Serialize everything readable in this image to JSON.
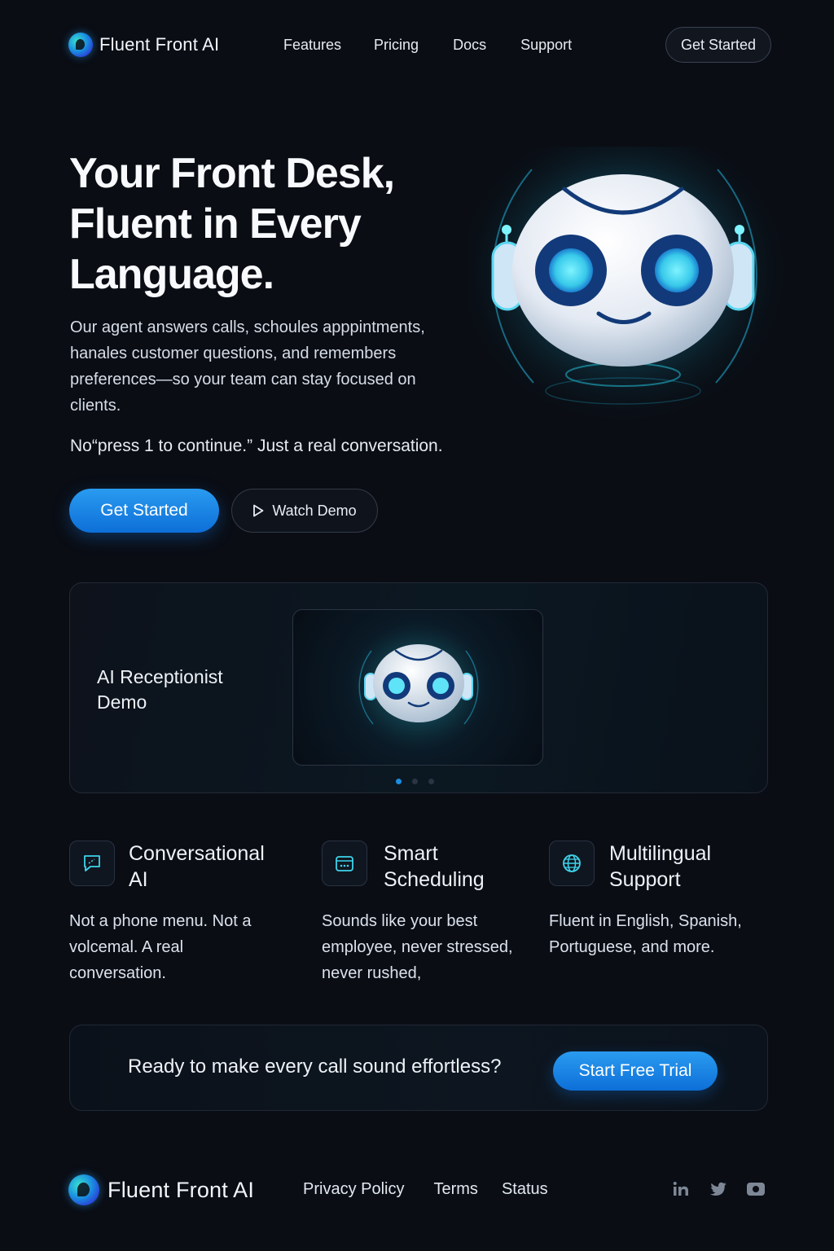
{
  "nav": {
    "brand": "Fluent Front AI",
    "links": [
      "Features",
      "Pricing",
      "Docs",
      "Support"
    ],
    "cta": "Get Started"
  },
  "hero": {
    "title_lines": [
      "Your Front Desk,",
      "Fluent in Every",
      "Language."
    ],
    "description": "Our agent answers calls, schoules apppintments, hanales customer questions, and remembers preferences—so your team can stay focused on clients.",
    "tagline": "No“press 1 to continue.” Just a real conversation.",
    "primary_button": "Get Started",
    "secondary_button": "Watch Demo",
    "secondary_icon": "play-icon"
  },
  "demo": {
    "title": "AI Receptionist Demo",
    "carousel_active": 1,
    "carousel_count": 3
  },
  "features": [
    {
      "icon": "chat-bubble-icon",
      "title": "Conversational AI",
      "description": "Not a phone menu. Not a volcemal.  A real conversation."
    },
    {
      "icon": "calendar-icon",
      "title": "Smart Scheduling",
      "description": "Sounds like your best employee, never stressed, never rushed,"
    },
    {
      "icon": "globe-icon",
      "title": "Multilingual Support",
      "description": "Fluent in English, Spanish, Portuguese, and more."
    }
  ],
  "cta": {
    "text": "Ready to make every call sound effortless?",
    "button": "Start Free Trial"
  },
  "footer": {
    "brand": "Fluent Front AI",
    "links": [
      "Privacy Policy",
      "Terms",
      "Status"
    ],
    "socials": [
      "linkedin-icon",
      "twitter-icon",
      "youtube-icon"
    ]
  },
  "colors": {
    "background": "#0a0d14",
    "accent": "#1b8ee0",
    "glow": "#2fe0e6"
  }
}
